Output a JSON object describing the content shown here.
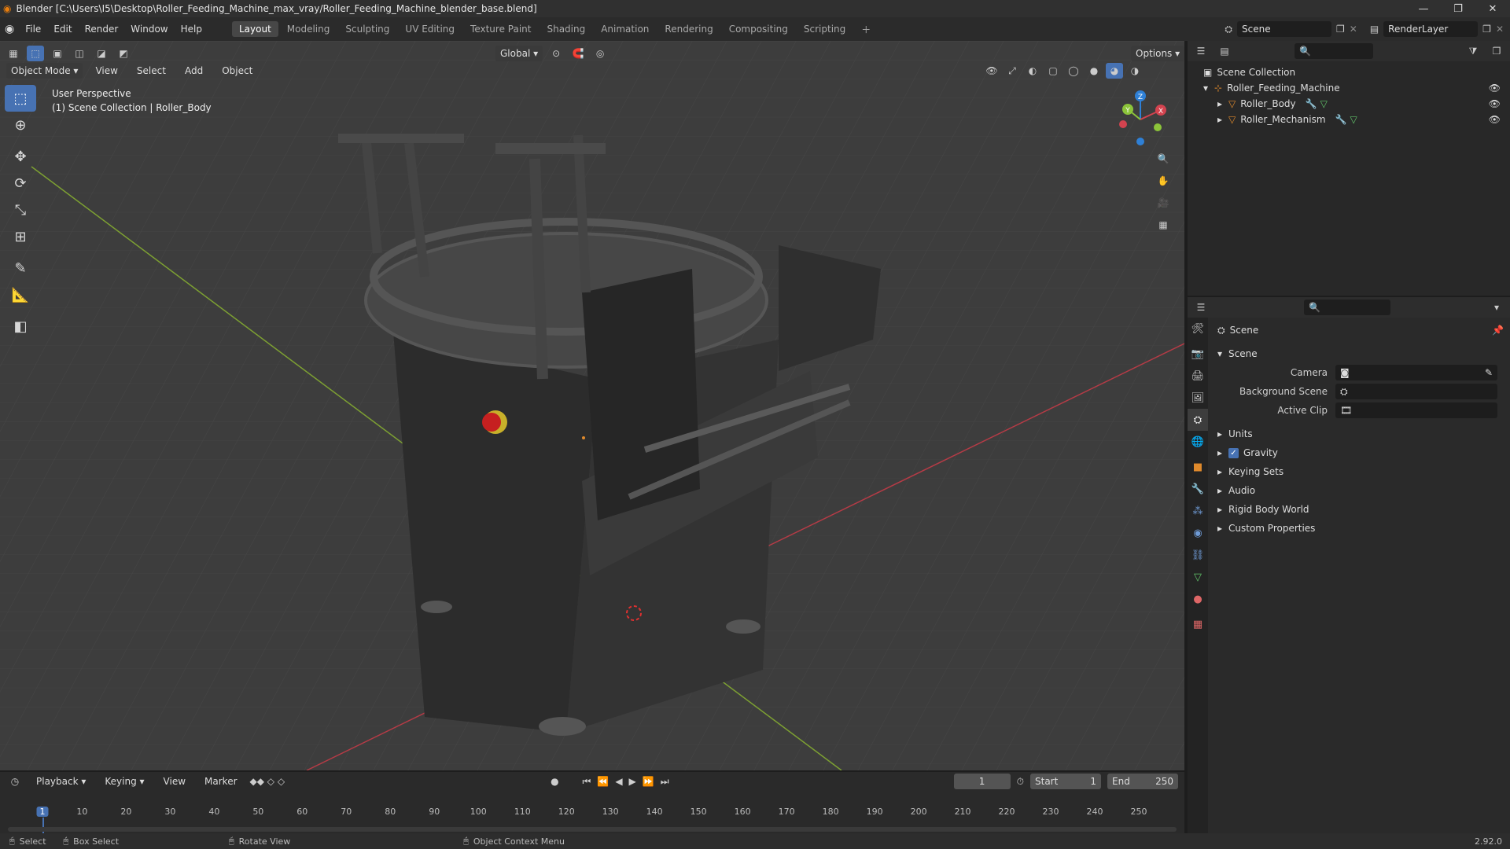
{
  "window": {
    "title": "Blender [C:\\Users\\I5\\Desktop\\Roller_Feeding_Machine_max_vray/Roller_Feeding_Machine_blender_base.blend]",
    "controls": [
      "—",
      "❐",
      "✕"
    ]
  },
  "menus": [
    "File",
    "Edit",
    "Render",
    "Window",
    "Help"
  ],
  "workspaces": [
    "Layout",
    "Modeling",
    "Sculpting",
    "UV Editing",
    "Texture Paint",
    "Shading",
    "Animation",
    "Rendering",
    "Compositing",
    "Scripting"
  ],
  "active_workspace": "Layout",
  "scene_name": "Scene",
  "view_layer": "RenderLayer",
  "viewport": {
    "mode": "Object Mode",
    "menus": [
      "View",
      "Select",
      "Add",
      "Object"
    ],
    "orientation": "Global",
    "options_label": "Options",
    "overlay_text1": "User Perspective",
    "overlay_text2": "(1) Scene Collection | Roller_Body",
    "gizmo": {
      "x": "X",
      "y": "Y",
      "z": "Z"
    }
  },
  "outliner": {
    "root": "Scene Collection",
    "items": [
      {
        "name": "Roller_Feeding_Machine",
        "level": 1
      },
      {
        "name": "Roller_Body",
        "level": 2
      },
      {
        "name": "Roller_Mechanism",
        "level": 2
      }
    ]
  },
  "properties": {
    "breadcrumb": "Scene",
    "panel": "Scene",
    "fields": [
      {
        "label": "Camera",
        "value": ""
      },
      {
        "label": "Background Scene",
        "value": ""
      },
      {
        "label": "Active Clip",
        "value": ""
      }
    ],
    "subpanels": [
      "Units",
      "Gravity",
      "Keying Sets",
      "Audio",
      "Rigid Body World",
      "Custom Properties"
    ]
  },
  "timeline": {
    "menus": [
      "Playback",
      "Keying",
      "View",
      "Marker"
    ],
    "current_frame": "1",
    "start_label": "Start",
    "start": "1",
    "end_label": "End",
    "end": "250",
    "ticks": [
      "1",
      "10",
      "20",
      "30",
      "40",
      "50",
      "60",
      "70",
      "80",
      "90",
      "100",
      "110",
      "120",
      "130",
      "140",
      "150",
      "160",
      "170",
      "180",
      "190",
      "200",
      "210",
      "220",
      "230",
      "240",
      "250"
    ]
  },
  "statusbar": {
    "select": "Select",
    "box_select": "Box Select",
    "rotate": "Rotate View",
    "context": "Object Context Menu",
    "version": "2.92.0"
  },
  "colors": {
    "accent": "#4772b3",
    "x_axis": "#d3434f",
    "y_axis": "#8cc43a",
    "z_axis": "#2f80d6",
    "object": "#e08a2c"
  }
}
